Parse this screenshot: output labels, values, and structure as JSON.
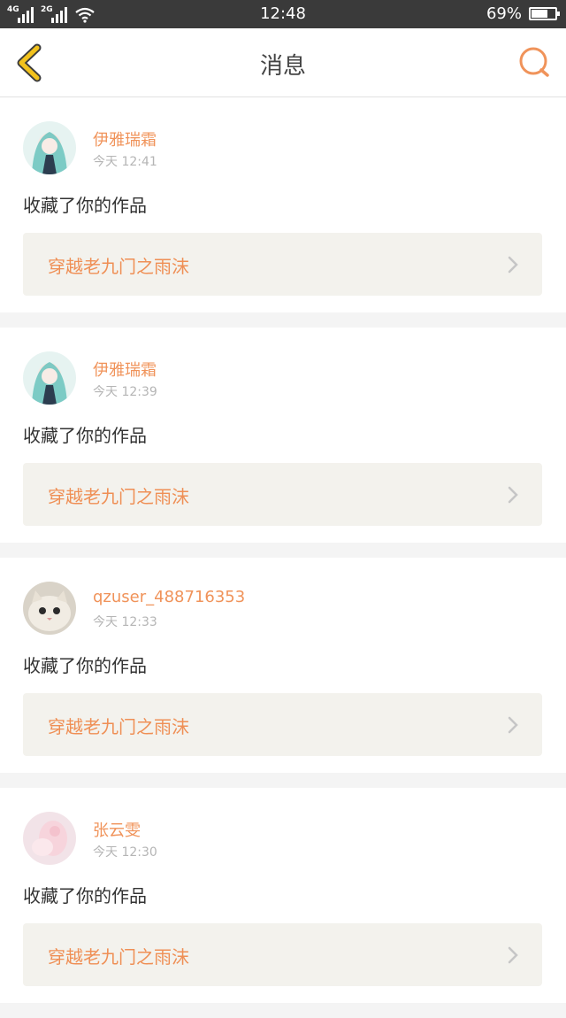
{
  "status_bar": {
    "net1": "4G",
    "net2": "2G",
    "time": "12:48",
    "battery": "69%",
    "battery_level": 0.69
  },
  "header": {
    "title": "消息",
    "back_icon": "chevron-left-icon",
    "search_icon": "search-icon"
  },
  "notifications": [
    {
      "user": "伊雅瑞霜",
      "time": "今天 12:41",
      "action": "收藏了你的作品",
      "work": "穿越老九门之雨沫",
      "avatar": "anime-girl-teal"
    },
    {
      "user": "伊雅瑞霜",
      "time": "今天 12:39",
      "action": "收藏了你的作品",
      "work": "穿越老九门之雨沫",
      "avatar": "anime-girl-teal"
    },
    {
      "user": "qzuser_488716353",
      "time": "今天 12:33",
      "action": "收藏了你的作品",
      "work": "穿越老九门之雨沫",
      "avatar": "cat-photo"
    },
    {
      "user": "张云雯",
      "time": "今天 12:30",
      "action": "收藏了你的作品",
      "work": "穿越老九门之雨沫",
      "avatar": "pink-hand-photo"
    }
  ],
  "colors": {
    "accent": "#f0935a",
    "back_icon": "#f2c21c",
    "status_bar": "#3a3a3a",
    "link_bg": "#f3f2ed"
  }
}
